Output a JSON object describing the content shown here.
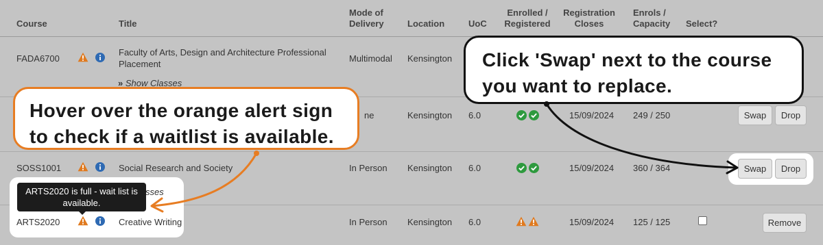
{
  "headers": {
    "course": "Course",
    "title": "Title",
    "mode": [
      "Mode of",
      "Delivery"
    ],
    "location": "Location",
    "uoc": "UoC",
    "enrolled": [
      "Enrolled /",
      "Registered"
    ],
    "reg_closes": [
      "Registration",
      "Closes"
    ],
    "enrols": [
      "Enrols /",
      "Capacity"
    ],
    "select": "Select?"
  },
  "rows": [
    {
      "code": "FADA6700",
      "title_line1": "Faculty of Arts, Design and Architecture Professional",
      "title_line2": "Placement",
      "mode": "Multimodal",
      "location": "Kensington",
      "show_classes": "Show Classes"
    },
    {
      "mode": "ne",
      "location": "Kensington",
      "uoc": "6.0",
      "closes": "15/09/2024",
      "enrols": "249 / 250",
      "swap": "Swap",
      "drop": "Drop"
    },
    {
      "code": "SOSS1001",
      "title": "Social Research and Society",
      "mode": "In Person",
      "location": "Kensington",
      "uoc": "6.0",
      "closes": "15/09/2024",
      "enrols": "360 / 364",
      "swap": "Swap",
      "drop": "Drop",
      "show_classes_partial": "sses"
    },
    {
      "code": "ARTS2020",
      "title": "Creative Writing",
      "mode": "In Person",
      "location": "Kensington",
      "uoc": "6.0",
      "closes": "15/09/2024",
      "enrols": "125 / 125",
      "remove": "Remove"
    }
  ],
  "tooltip": {
    "line1": "ARTS2020 is full - wait list is",
    "line2": "available."
  },
  "callouts": {
    "alert_line1": "Hover over the orange alert sign",
    "alert_line2": "to check if a waitlist is available.",
    "swap_line1": "Click 'Swap' next to the course",
    "swap_line2": "you want to replace."
  },
  "colors": {
    "background": "#c4c4c4",
    "alert_orange": "#e07a1f",
    "info_blue": "#2e6ab3",
    "check_green": "#2e9a3e",
    "callout_border_orange": "#e77d23"
  },
  "icons": [
    "warning-icon",
    "info-icon",
    "check-circle-icon",
    "chevron-right-icon"
  ]
}
